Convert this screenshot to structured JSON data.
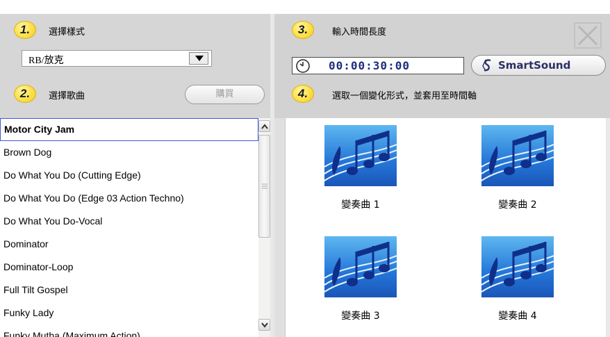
{
  "steps": {
    "step1": {
      "number": "1.",
      "label": "選擇樣式"
    },
    "step2": {
      "number": "2.",
      "label": "選擇歌曲"
    },
    "step3": {
      "number": "3.",
      "label": "輸入時間長度"
    },
    "step4": {
      "number": "4.",
      "label": "選取一個變化形式，並套用至時間軸"
    }
  },
  "style_select": {
    "value": "RB/放克"
  },
  "buy_button": {
    "label": "購買",
    "enabled": false
  },
  "duration": {
    "value": "00:00:30:00"
  },
  "smartsound_button": {
    "label": "SmartSound"
  },
  "songs": [
    {
      "title": "Motor City Jam",
      "selected": true
    },
    {
      "title": "Brown Dog"
    },
    {
      "title": "Do What You Do (Cutting Edge)"
    },
    {
      "title": "Do What You Do (Edge 03 Action Techno)"
    },
    {
      "title": "Do What You Do-Vocal"
    },
    {
      "title": "Dominator"
    },
    {
      "title": "Dominator-Loop"
    },
    {
      "title": "Full Tilt Gospel"
    },
    {
      "title": "Funky Lady"
    },
    {
      "title": "Funky Mutha (Maximum Action)"
    }
  ],
  "variations": [
    {
      "label": "變奏曲 1",
      "icon": "music-notes-icon"
    },
    {
      "label": "變奏曲 2",
      "icon": "music-notes-icon"
    },
    {
      "label": "變奏曲 3",
      "icon": "music-notes-icon"
    },
    {
      "label": "變奏曲 4",
      "icon": "music-notes-icon"
    }
  ],
  "colors": {
    "badge": "#ffe45a",
    "selection_border": "#3b5bd6",
    "time_text": "#1f2f7a",
    "panel_bg": "#d6d6d6"
  }
}
